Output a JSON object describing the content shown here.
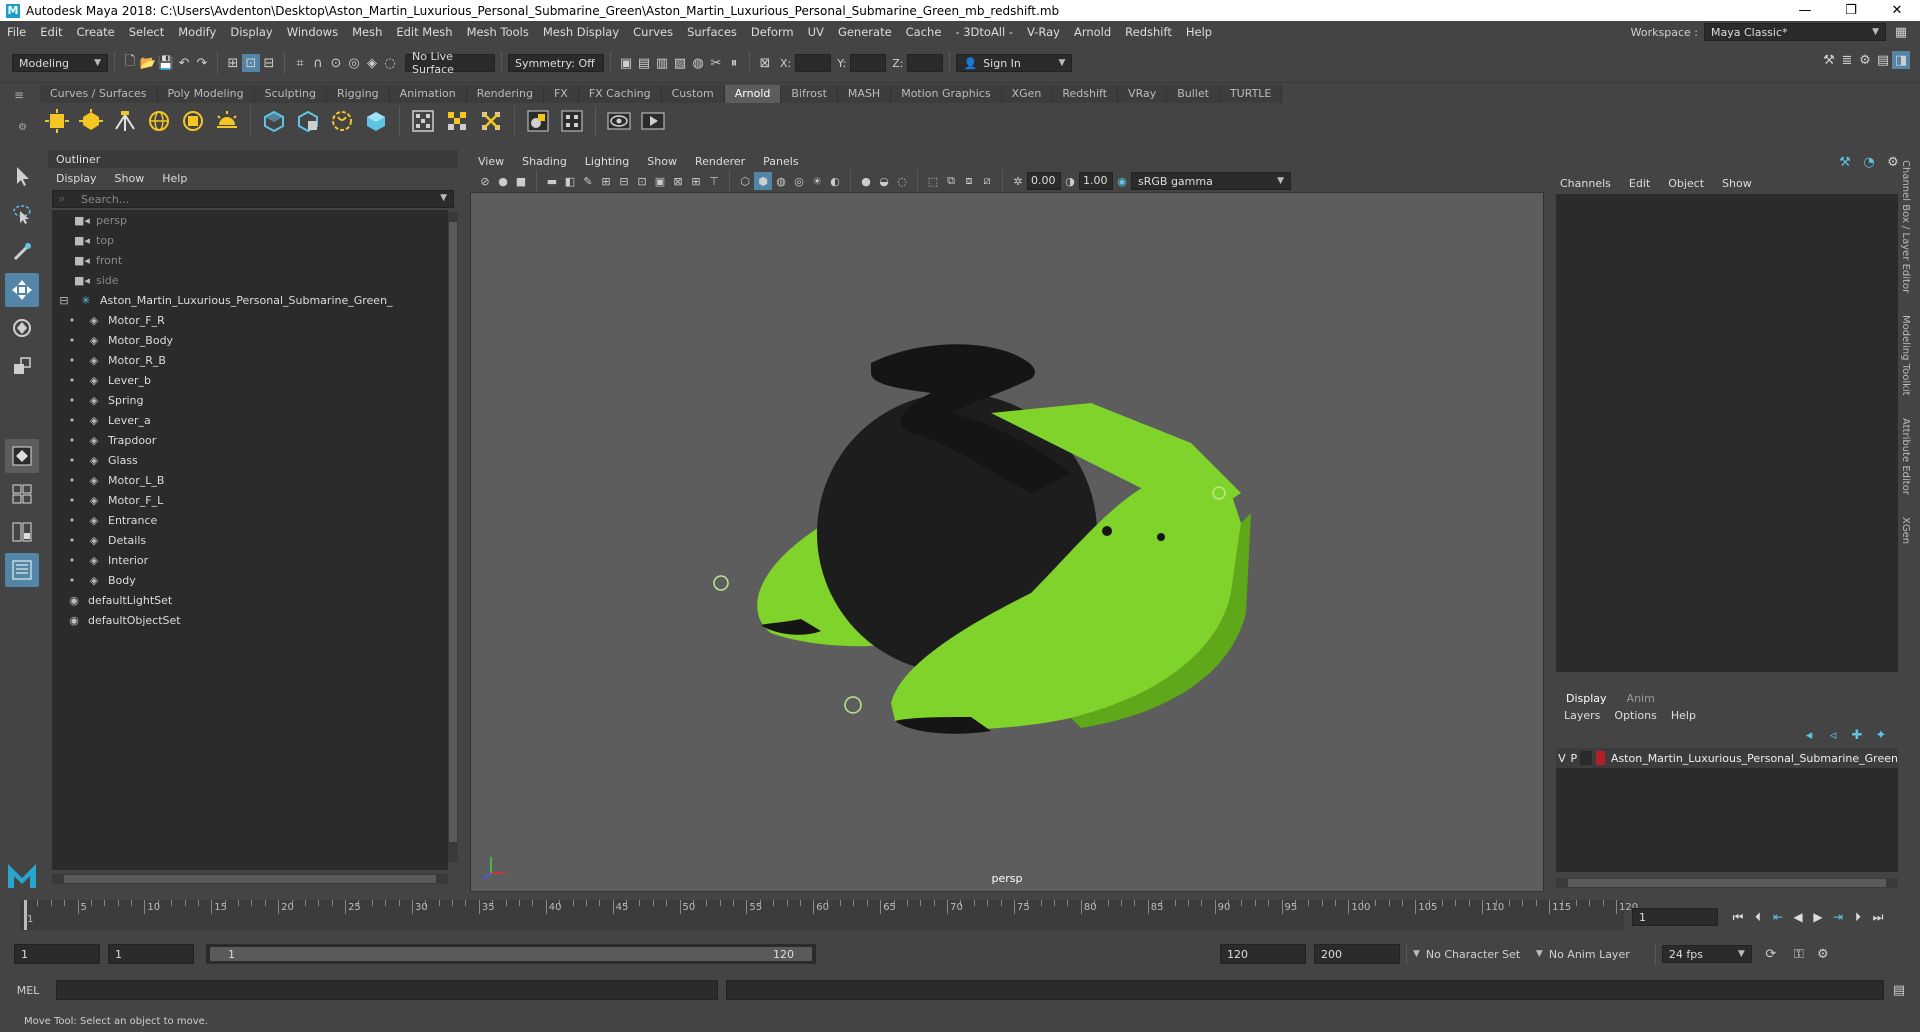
{
  "window": {
    "title": "Autodesk Maya 2018: C:\\Users\\Avdenton\\Desktop\\Aston_Martin_Luxurious_Personal_Submarine_Green\\Aston_Martin_Luxurious_Personal_Submarine_Green_mb_redshift.mb",
    "minimize": "—",
    "maximize": "❐",
    "close": "✕"
  },
  "menubar": {
    "items": [
      "File",
      "Edit",
      "Create",
      "Select",
      "Modify",
      "Display",
      "Windows",
      "Mesh",
      "Edit Mesh",
      "Mesh Tools",
      "Mesh Display",
      "Curves",
      "Surfaces",
      "Deform",
      "UV",
      "Generate",
      "Cache",
      "- 3DtoAll -",
      "V-Ray",
      "Arnold",
      "Redshift",
      "Help"
    ],
    "workspace_label": "Workspace :",
    "workspace_value": "Maya Classic*"
  },
  "statusline": {
    "mode": "Modeling",
    "live_surface": "No Live Surface",
    "symmetry": "Symmetry: Off",
    "x_label": "X:",
    "y_label": "Y:",
    "z_label": "Z:",
    "sign_in": "Sign In"
  },
  "shelf": {
    "tabs": [
      "Curves / Surfaces",
      "Poly Modeling",
      "Sculpting",
      "Rigging",
      "Animation",
      "Rendering",
      "FX",
      "FX Caching",
      "Custom",
      "Arnold",
      "Bifrost",
      "MASH",
      "Motion Graphics",
      "XGen",
      "Redshift",
      "VRay",
      "Bullet",
      "TURTLE"
    ],
    "active": "Arnold"
  },
  "outliner": {
    "title": "Outliner",
    "menu": [
      "Display",
      "Show",
      "Help"
    ],
    "search_placeholder": "Search...",
    "cameras": [
      "persp",
      "top",
      "front",
      "side"
    ],
    "root": "Aston_Martin_Luxurious_Personal_Submarine_Green_",
    "children": [
      "Motor_F_R",
      "Motor_Body",
      "Motor_R_B",
      "Lever_b",
      "Spring",
      "Lever_a",
      "Trapdoor",
      "Glass",
      "Motor_L_B",
      "Motor_F_L",
      "Entrance",
      "Details",
      "Interior",
      "Body"
    ],
    "sets": [
      "defaultLightSet",
      "defaultObjectSet"
    ]
  },
  "viewport": {
    "menu": [
      "View",
      "Shading",
      "Lighting",
      "Show",
      "Renderer",
      "Panels"
    ],
    "exposure": "0.00",
    "gamma": "1.00",
    "color_space": "sRGB gamma",
    "camera": "persp",
    "model_colors": {
      "hull": "#7fd32a",
      "hull_shade": "#5ea81a",
      "sphere": "#1d1d1d",
      "dark": "#151515"
    }
  },
  "channelbox": {
    "menu": [
      "Channels",
      "Edit",
      "Object",
      "Show"
    ],
    "side_tabs": [
      "Channel Box / Layer Editor",
      "Modeling Toolkit",
      "Attribute Editor",
      "XGen"
    ]
  },
  "layers": {
    "tabs": [
      "Display",
      "Anim"
    ],
    "menu": [
      "Layers",
      "Options",
      "Help"
    ],
    "row": {
      "v": "V",
      "p": "P",
      "name": "Aston_Martin_Luxurious_Personal_Submarine_Green"
    }
  },
  "timeline": {
    "ticks": [
      1,
      5,
      10,
      15,
      20,
      25,
      30,
      35,
      40,
      45,
      50,
      55,
      60,
      65,
      70,
      75,
      80,
      85,
      90,
      95,
      100,
      105,
      110,
      115,
      120
    ],
    "current_frame": "1"
  },
  "range": {
    "start": "1",
    "playback_start": "1",
    "slider_start": "1",
    "slider_end": "120",
    "playback_end": "120",
    "end": "200",
    "character_set": "No Character Set",
    "anim_layer": "No Anim Layer",
    "fps": "24 fps"
  },
  "mel": {
    "label": "MEL"
  },
  "help": {
    "text": "Move Tool: Select an object to move."
  }
}
